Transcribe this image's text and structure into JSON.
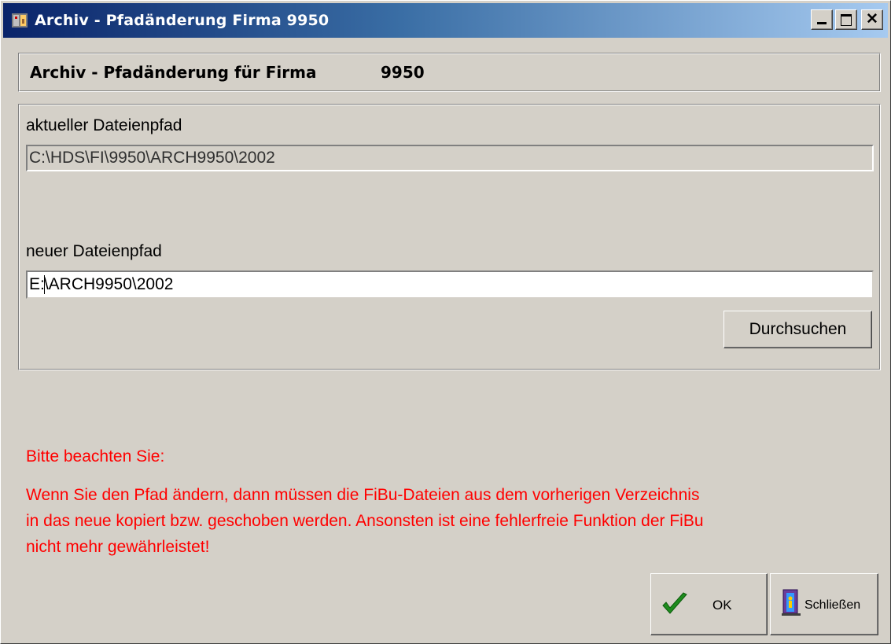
{
  "window": {
    "title": "Archiv - Pfadänderung Firma 9950",
    "controls": [
      "minimize",
      "maximize",
      "close"
    ]
  },
  "header": {
    "title": "Archiv - Pfadänderung für Firma",
    "company_number": "9950"
  },
  "current_path": {
    "label": "aktueller Dateienpfad",
    "value": "C:\\HDS\\FI\\9950\\ARCH9950\\2002"
  },
  "new_path": {
    "label": "neuer Dateienpfad",
    "value_before_caret": "E:",
    "value_after_caret": "\\ARCH9950\\2002"
  },
  "browse_button": {
    "label": "Durchsuchen"
  },
  "warning": {
    "heading": "Bitte beachten Sie:",
    "line1": "Wenn Sie den Pfad ändern, dann müssen die FiBu-Dateien aus dem vorherigen Verzeichnis",
    "line2": "in das neue kopiert bzw. geschoben werden. Ansonsten ist eine fehlerfreie Funktion der FiBu",
    "line3": "nicht mehr gewährleistet!",
    "color": "#ff0000"
  },
  "buttons": {
    "ok": {
      "label": "OK",
      "icon": "checkmark-icon"
    },
    "close": {
      "label": "Schließen",
      "icon": "exit-door-icon"
    }
  },
  "colors": {
    "titlebar_start": "#0a246a",
    "titlebar_end": "#a6caf0",
    "face": "#d4d0c8"
  }
}
